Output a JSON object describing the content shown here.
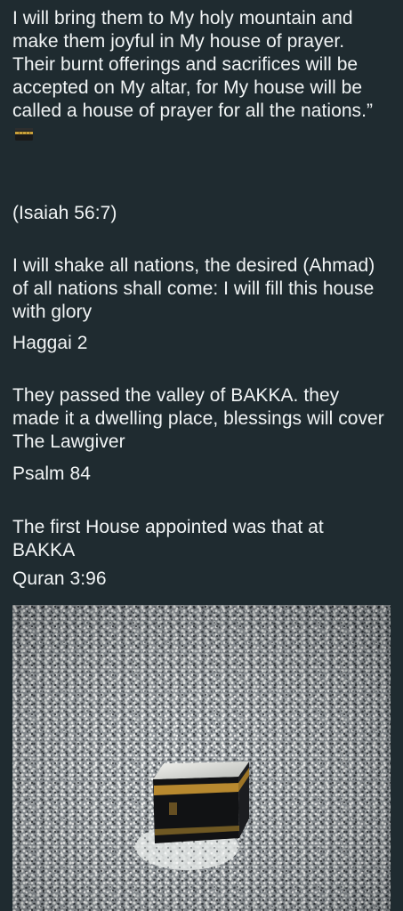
{
  "message": {
    "paragraph1": "I will bring them to My holy mountain and make them joyful in My house of prayer. Their burnt offerings and sacrifices will be accepted on My altar, for My house will be called a house of prayer for all the nations.”",
    "emoji": "kaaba-emoji",
    "paragraph2": "(Isaiah 56:7)",
    "paragraph3": "I will shake all nations, the desired (Ahmad) of all nations shall come: I will fill this house with glory",
    "paragraph3_ref": "Haggai 2",
    "paragraph4": "They passed the valley of BAKKA. they made it a dwelling place, blessings will cover The Lawgiver",
    "paragraph4_ref": "Psalm 84",
    "paragraph5": "The first House appointed was that at BAKKA",
    "paragraph5_ref": "Quran 3:96"
  },
  "photo": {
    "subject": "kaaba-aerial-photo"
  },
  "colors": {
    "background": "#1f2b30",
    "text": "#f1f4f5",
    "crowd_light": "#e9ece9",
    "crowd_dark": "#2d3236",
    "kaaba_black": "#111214",
    "kaaba_gold": "#b8892f"
  }
}
